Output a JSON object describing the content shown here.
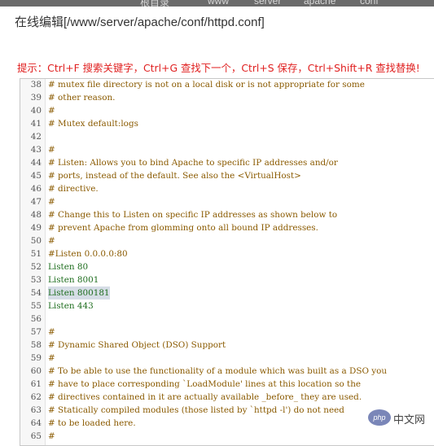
{
  "background_tabs": [
    "根目录",
    "www",
    "server",
    "apache",
    "conf"
  ],
  "dialog": {
    "title": "在线编辑[/www/server/apache/conf/httpd.conf]",
    "hint": "提示：Ctrl+F 搜索关键字，Ctrl+G 查找下一个，Ctrl+S 保存，Ctrl+Shift+R 查找替换!"
  },
  "editor": {
    "lines": [
      {
        "num": "38",
        "text": "# mutex file directory is not on a local disk or is not appropriate for some",
        "style": "comment"
      },
      {
        "num": "39",
        "text": "# other reason.",
        "style": "comment"
      },
      {
        "num": "40",
        "text": "#",
        "style": "comment"
      },
      {
        "num": "41",
        "text": "# Mutex default:logs",
        "style": "comment"
      },
      {
        "num": "42",
        "text": "",
        "style": "comment"
      },
      {
        "num": "43",
        "text": "#",
        "style": "comment"
      },
      {
        "num": "44",
        "text": "# Listen: Allows you to bind Apache to specific IP addresses and/or",
        "style": "comment"
      },
      {
        "num": "45",
        "text": "# ports, instead of the default. See also the <VirtualHost>",
        "style": "comment"
      },
      {
        "num": "46",
        "text": "# directive.",
        "style": "comment"
      },
      {
        "num": "47",
        "text": "#",
        "style": "comment"
      },
      {
        "num": "48",
        "text": "# Change this to Listen on specific IP addresses as shown below to",
        "style": "comment"
      },
      {
        "num": "49",
        "text": "# prevent Apache from glomming onto all bound IP addresses.",
        "style": "comment"
      },
      {
        "num": "50",
        "text": "#",
        "style": "comment"
      },
      {
        "num": "51",
        "text": "#Listen 0.0.0.0:80",
        "style": "comment"
      },
      {
        "num": "52",
        "text": "Listen 80",
        "style": "plain"
      },
      {
        "num": "53",
        "text": "Listen 8001",
        "style": "plain"
      },
      {
        "num": "54",
        "text": "Listen 800181",
        "style": "selected"
      },
      {
        "num": "55",
        "text": "Listen 443",
        "style": "plain"
      },
      {
        "num": "56",
        "text": "",
        "style": "comment"
      },
      {
        "num": "57",
        "text": "#",
        "style": "comment"
      },
      {
        "num": "58",
        "text": "# Dynamic Shared Object (DSO) Support",
        "style": "comment"
      },
      {
        "num": "59",
        "text": "#",
        "style": "comment"
      },
      {
        "num": "60",
        "text": "# To be able to use the functionality of a module which was built as a DSO you",
        "style": "comment"
      },
      {
        "num": "61",
        "text": "# have to place corresponding `LoadModule' lines at this location so the",
        "style": "comment"
      },
      {
        "num": "62",
        "text": "# directives contained in it are actually available _before_ they are used.",
        "style": "comment"
      },
      {
        "num": "63",
        "text": "# Statically compiled modules (those listed by `httpd -l') do not need",
        "style": "comment"
      },
      {
        "num": "64",
        "text": "# to be loaded here.",
        "style": "comment"
      },
      {
        "num": "65",
        "text": "#",
        "style": "comment"
      }
    ]
  },
  "watermark": {
    "logo_text": "php",
    "site_text": "中文网"
  }
}
